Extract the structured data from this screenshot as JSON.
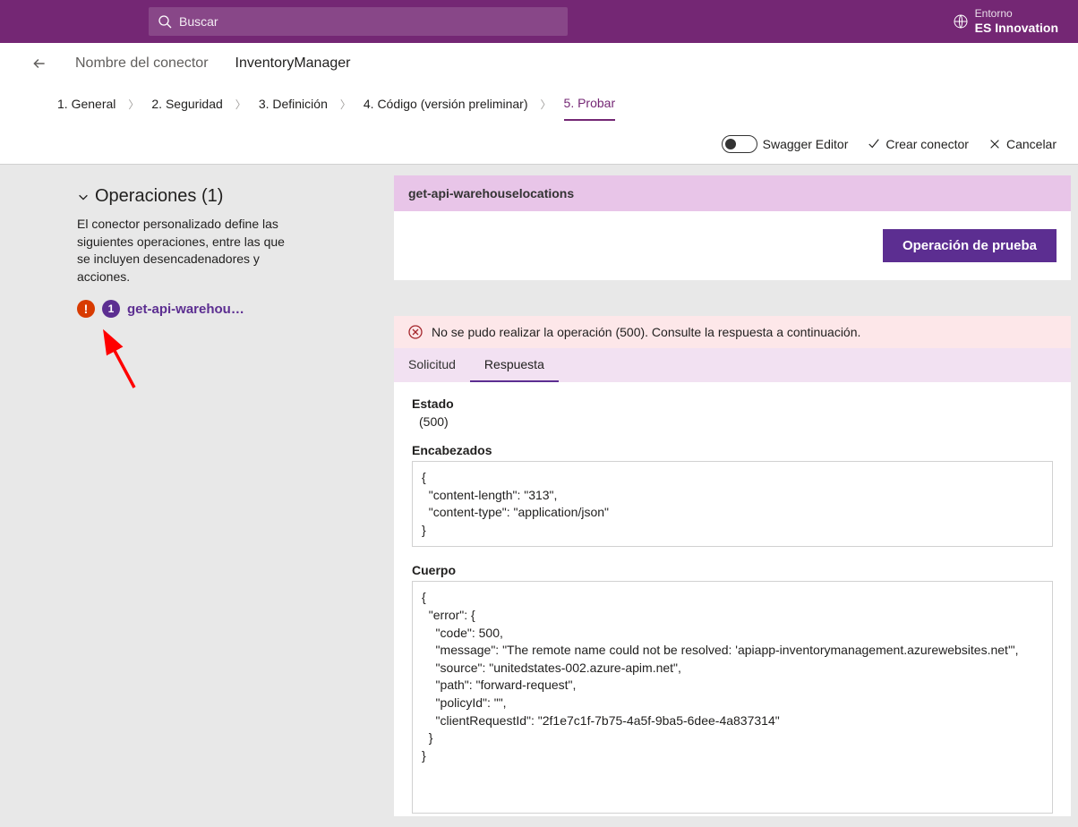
{
  "header": {
    "search_placeholder": "Buscar",
    "env_label": "Entorno",
    "env_value": "ES Innovation"
  },
  "connector": {
    "label": "Nombre del conector",
    "name": "InventoryManager"
  },
  "wizard": {
    "steps": [
      "1. General",
      "2. Seguridad",
      "3. Definición",
      "4. Código (versión preliminar)",
      "5. Probar"
    ]
  },
  "actions": {
    "swagger": "Swagger Editor",
    "create": "Crear conector",
    "cancel": "Cancelar"
  },
  "operations": {
    "title": "Operaciones (1)",
    "description": "El conector personalizado define las siguientes operaciones, entre las que se incluyen desencadenadores y acciones.",
    "item_badge": "1",
    "item_name": "get-api-warehou…"
  },
  "detail": {
    "title": "get-api-warehouselocations",
    "test_button": "Operación de prueba",
    "error_message": "No se pudo realizar la operación (500). Consulte la respuesta a continuación.",
    "tabs": {
      "request": "Solicitud",
      "response": "Respuesta"
    },
    "status_label": "Estado",
    "status_value": "(500)",
    "headers_label": "Encabezados",
    "headers_value": "{\n  \"content-length\": \"313\",\n  \"content-type\": \"application/json\"\n}",
    "body_label": "Cuerpo",
    "body_value": "{\n  \"error\": {\n    \"code\": 500,\n    \"message\": \"The remote name could not be resolved: 'apiapp-inventorymanagement.azurewebsites.net'\",\n    \"source\": \"unitedstates-002.azure-apim.net\",\n    \"path\": \"forward-request\",\n    \"policyId\": \"\",\n    \"clientRequestId\": \"2f1e7c1f-7b75-4a5f-9ba5-6dee-4a837314\"\n  }\n}"
  }
}
